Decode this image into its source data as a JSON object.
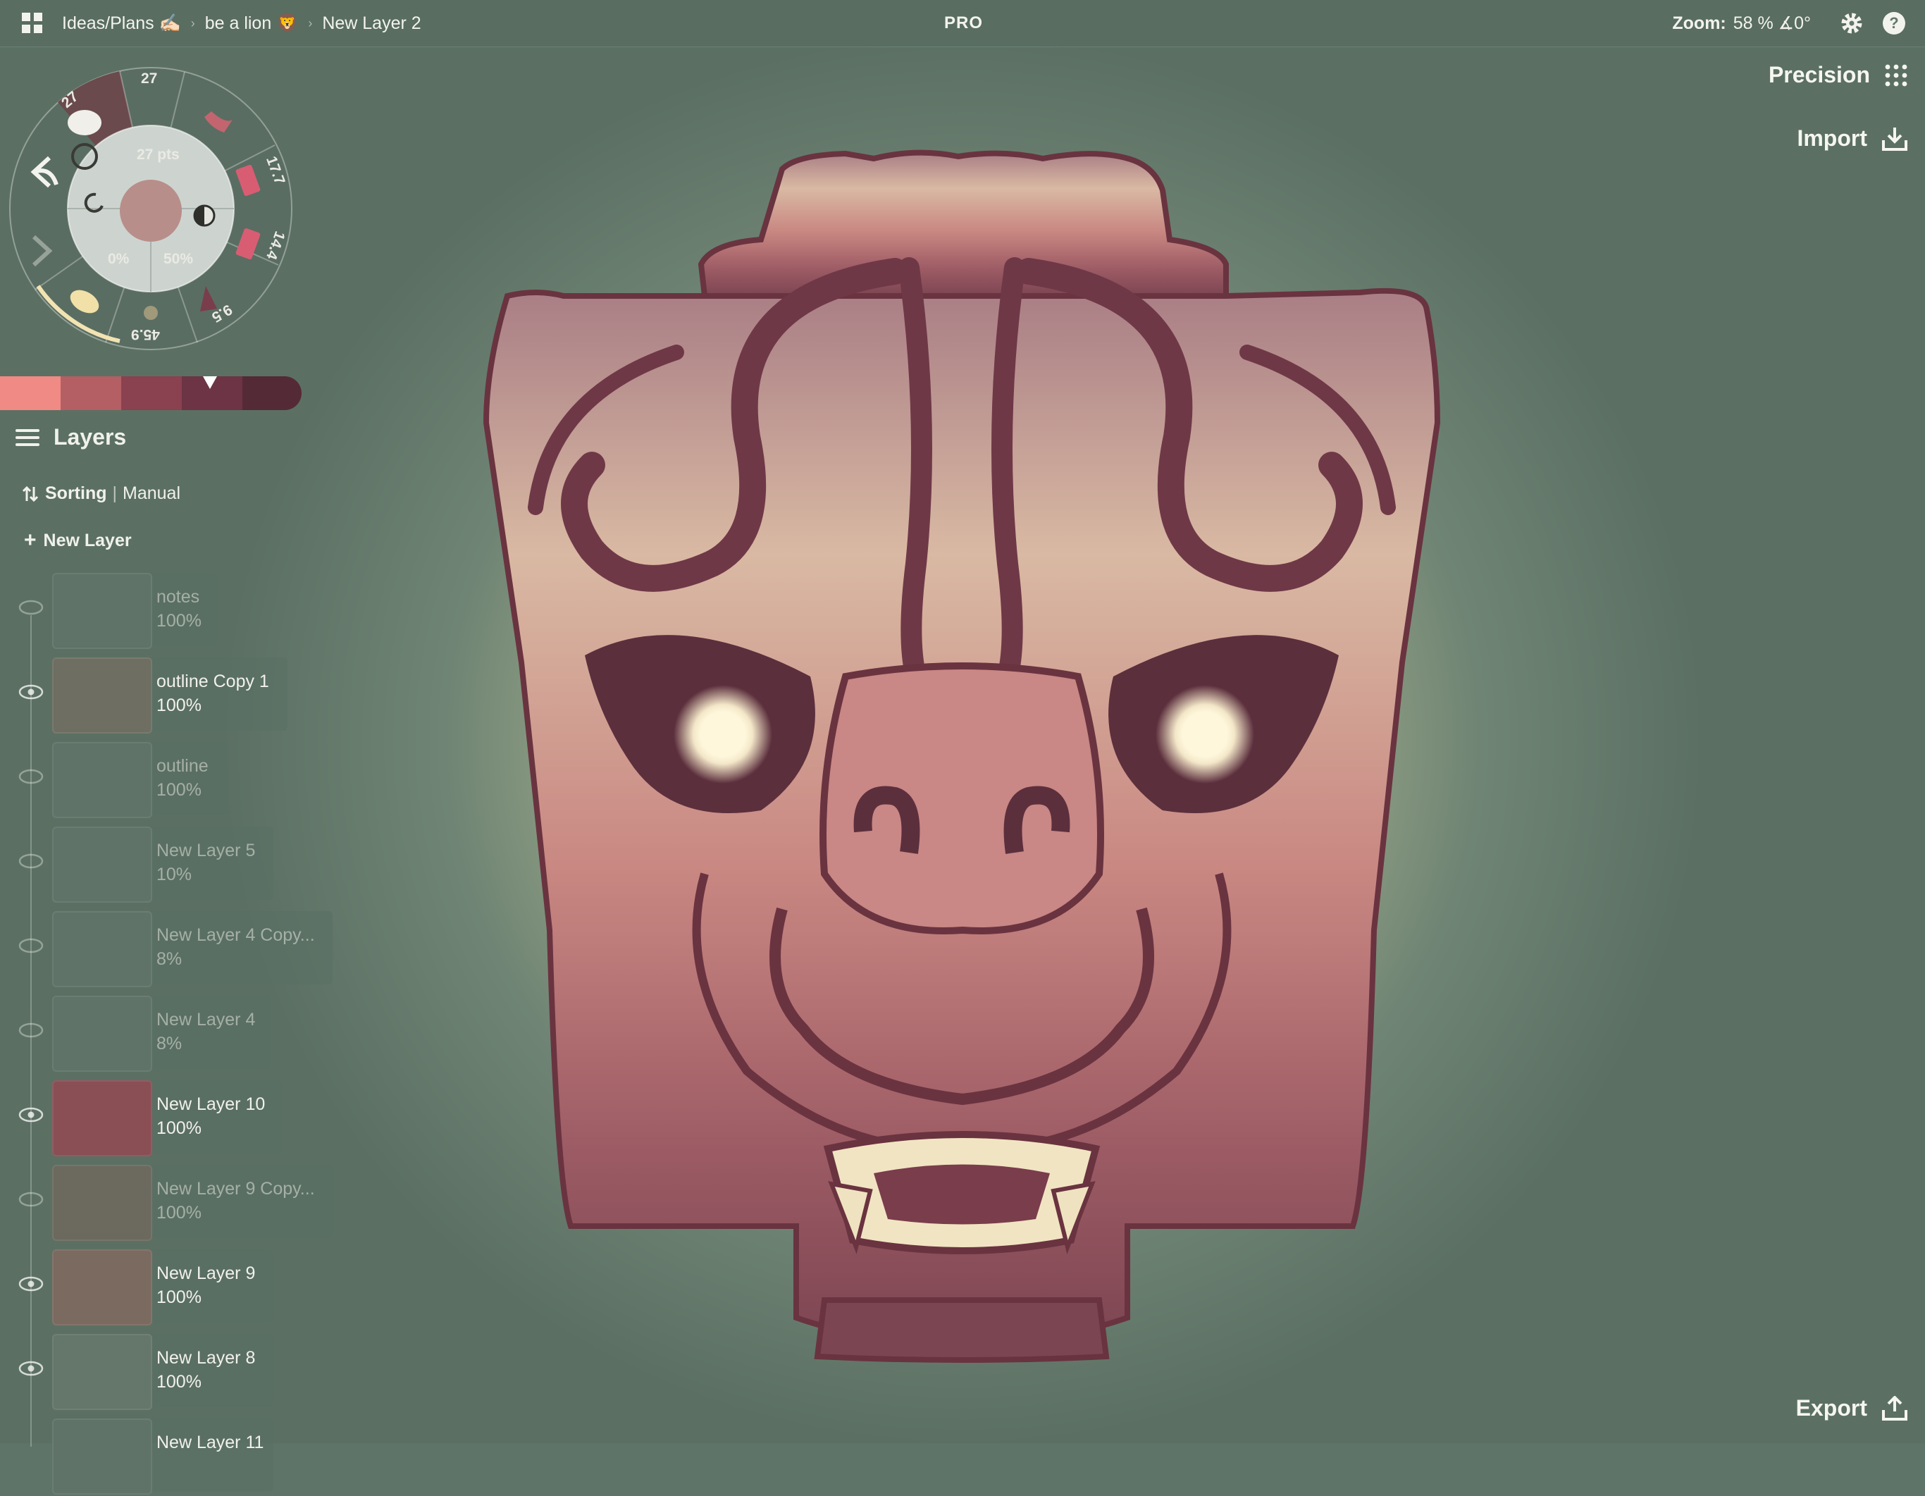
{
  "topbar": {
    "breadcrumbs": [
      "Ideas/Plans ✍🏻",
      "be a lion 🦁",
      "New Layer 2"
    ],
    "pro_label": "PRO",
    "zoom_label": "Zoom:",
    "zoom_value": "58 % ∡0°"
  },
  "right_panel": {
    "precision_label": "Precision",
    "import_label": "Import",
    "export_label": "Export"
  },
  "brush_wheel": {
    "size_value": "27 pts",
    "opacity_value": "0%",
    "smoothing_value": "50%",
    "tool_sizes": [
      "27",
      "27",
      "17.7",
      "14.4",
      "9.5",
      "45.9"
    ]
  },
  "colors": {
    "swatches": [
      "#f08a84",
      "#b45f64",
      "#8a4150",
      "#6c3444",
      "#552a37"
    ],
    "accent": "#d85d73"
  },
  "layers_panel": {
    "title": "Layers",
    "sorting_label": "Sorting",
    "sorting_value": "Manual",
    "new_layer_label": "New Layer",
    "items": [
      {
        "name": "notes",
        "opacity": "100%"
      },
      {
        "name": "outline Copy 1",
        "opacity": "100%"
      },
      {
        "name": "outline",
        "opacity": "100%"
      },
      {
        "name": "New Layer 5",
        "opacity": "10%"
      },
      {
        "name": "New Layer 4 Copy...",
        "opacity": "8%"
      },
      {
        "name": "New Layer 4",
        "opacity": "8%"
      },
      {
        "name": "New Layer 10",
        "opacity": "100%"
      },
      {
        "name": "New Layer 9 Copy...",
        "opacity": "100%"
      },
      {
        "name": "New Layer 9",
        "opacity": "100%"
      },
      {
        "name": "New Layer 8",
        "opacity": "100%"
      },
      {
        "name": "New Layer 11",
        "opacity": ""
      }
    ]
  }
}
